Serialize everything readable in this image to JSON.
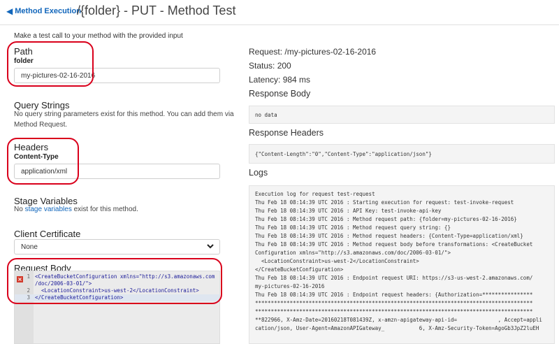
{
  "header": {
    "back_label": "Method Execution",
    "title": "/{folder} - PUT - Method Test"
  },
  "intro": "Make a test call to your method with the provided input",
  "path": {
    "title": "Path",
    "label": "folder",
    "value": "my-pictures-02-16-2016"
  },
  "query_strings": {
    "title": "Query Strings",
    "line1": "No query string parameters exist for this method. You can add them via",
    "line2": "Method Request."
  },
  "headers": {
    "title": "Headers",
    "label": "Content-Type",
    "value": "application/xml"
  },
  "stage_variables": {
    "title": "Stage Variables",
    "prefix": "No",
    "link": "stage variables",
    "suffix": "exist for this method."
  },
  "client_certificate": {
    "title": "Client Certificate",
    "selected": "None"
  },
  "request_body": {
    "title": "Request Body",
    "lines": [
      {
        "num": "1",
        "text": "<CreateBucketConfiguration xmlns=\"http://s3.amazonaws.com"
      },
      {
        "num": "",
        "text": "/doc/2006-03-01/\">"
      },
      {
        "num": "2",
        "text": "  <LocationConstraint>us-west-2</LocationConstraint>"
      },
      {
        "num": "3",
        "text": "</CreateBucketConfiguration>"
      }
    ]
  },
  "response": {
    "request_line": "Request: /my-pictures-02-16-2016",
    "status_line": "Status: 200",
    "latency_line": "Latency: 984 ms",
    "body_title": "Response Body",
    "body": "no data",
    "headers_title": "Response Headers",
    "headers": "{\"Content-Length\":\"0\",\"Content-Type\":\"application/json\"}",
    "logs_title": "Logs",
    "logs": [
      "Execution log for request test-request",
      "Thu Feb 18 08:14:39 UTC 2016 : Starting execution for request: test-invoke-request",
      "Thu Feb 18 08:14:39 UTC 2016 : API Key: test-invoke-api-key",
      "Thu Feb 18 08:14:39 UTC 2016 : Method request path: {folder=my-pictures-02-16-2016}",
      "Thu Feb 18 08:14:39 UTC 2016 : Method request query string: {}",
      "Thu Feb 18 08:14:39 UTC 2016 : Method request headers: {Content-Type=application/xml}",
      "Thu Feb 18 08:14:39 UTC 2016 : Method request body before transformations: <CreateBucket",
      "Configuration xmlns=\"http://s3.amazonaws.com/doc/2006-03-01/\">",
      "  <LocationConstraint>us-west-2</LocationConstraint>",
      "</CreateBucketConfiguration>",
      "Thu Feb 18 08:14:39 UTC 2016 : Endpoint request URI: https://s3-us-west-2.amazonaws.com/",
      "my-pictures-02-16-2016",
      "Thu Feb 18 08:14:39 UTC 2016 : Endpoint request headers: {Authorization=****************",
      "****************************************************************************************",
      "****************************************************************************************",
      "**822966, X-Amz-Date=20160218T081439Z, x-amzn-apigateway-api-id=             , Accept=appli",
      "cation/json, User-Agent=AmazonAPIGateway_           6, X-Amz-Security-Token=AgoGb3JpZ2luEH"
    ]
  },
  "colors": {
    "accent": "#1166bb",
    "annotation": "#d9001b",
    "error": "#d23a2b"
  },
  "icons": [
    "arrow-left-icon",
    "chevron-down-icon",
    "error-icon"
  ]
}
